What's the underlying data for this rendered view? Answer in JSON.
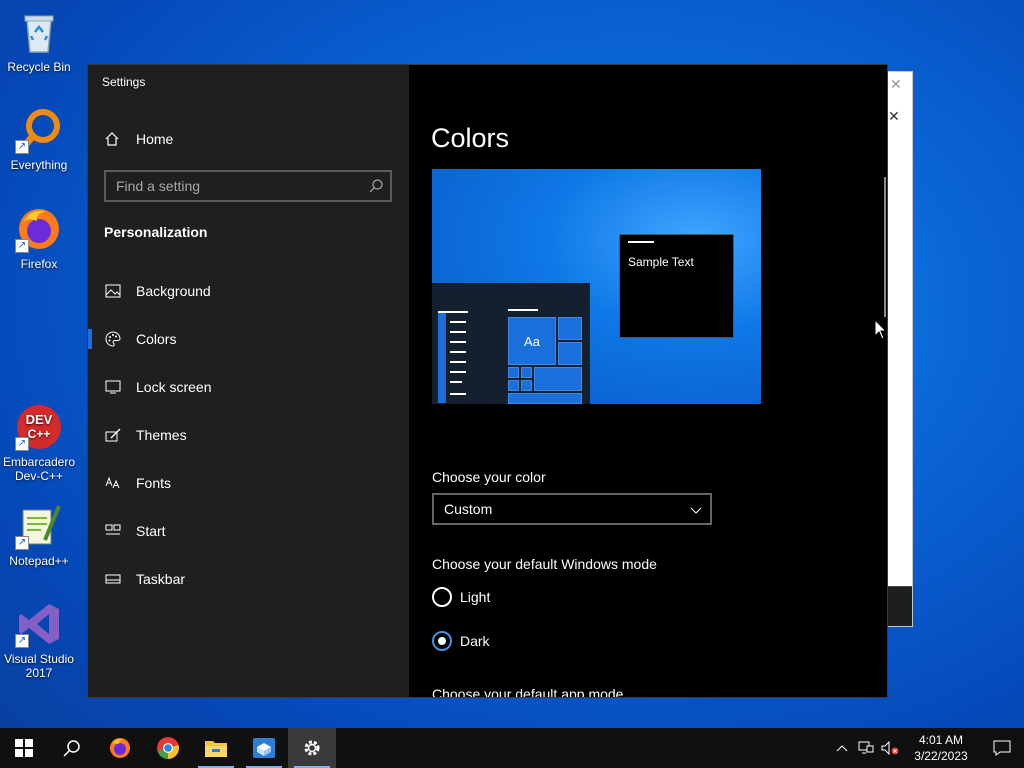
{
  "desktop": {
    "icons": [
      {
        "label": "Recycle Bin",
        "icon": "recycle-bin-icon"
      },
      {
        "label": "Everything",
        "icon": "everything-icon"
      },
      {
        "label": "Firefox",
        "icon": "firefox-icon"
      },
      {
        "label": "Embarcadero Dev-C++",
        "icon": "devcpp-icon",
        "badge": "DEV C++"
      },
      {
        "label": "Notepad++",
        "icon": "notepadpp-icon"
      },
      {
        "label": "Visual Studio 2017",
        "icon": "visual-studio-icon"
      }
    ]
  },
  "settings": {
    "app_title": "Settings",
    "home_label": "Home",
    "search_placeholder": "Find a setting",
    "section_title": "Personalization",
    "nav_items": [
      {
        "label": "Background",
        "icon": "picture-icon"
      },
      {
        "label": "Colors",
        "icon": "palette-icon",
        "active": true
      },
      {
        "label": "Lock screen",
        "icon": "lock-screen-icon"
      },
      {
        "label": "Themes",
        "icon": "brush-icon"
      },
      {
        "label": "Fonts",
        "icon": "font-icon"
      },
      {
        "label": "Start",
        "icon": "start-icon"
      },
      {
        "label": "Taskbar",
        "icon": "taskbar-icon"
      }
    ],
    "page_title": "Colors",
    "preview": {
      "sample_text": "Sample Text",
      "tile_text": "Aa"
    },
    "choose_color_label": "Choose your color",
    "color_select_value": "Custom",
    "windows_mode_label": "Choose your default Windows mode",
    "modes": [
      {
        "label": "Light",
        "checked": false
      },
      {
        "label": "Dark",
        "checked": true
      }
    ],
    "app_mode_label": "Choose your default app mode",
    "accent_color": "#1a6fdb"
  },
  "taskbar": {
    "apps": [
      "start-icon",
      "search-icon",
      "firefox-icon",
      "chrome-icon",
      "file-explorer-icon",
      "sandbox-icon",
      "settings-icon"
    ],
    "clock_time": "4:01 AM",
    "clock_date": "3/22/2023"
  }
}
